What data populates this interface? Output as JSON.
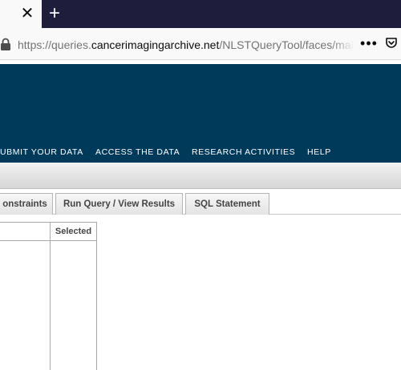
{
  "browser": {
    "tab_close_glyph": "✕",
    "new_tab_glyph": "+",
    "url_prefix": "https://queries.",
    "url_domain": "cancerimagingarchive.net",
    "url_path": "/NLSTQueryTool/faces/main.",
    "menu_glyph": "•••"
  },
  "header": {
    "nav": [
      "UBMIT YOUR DATA",
      "ACCESS THE DATA",
      "RESEARCH ACTIVITIES",
      "HELP"
    ]
  },
  "tabs": [
    {
      "label": "onstraints"
    },
    {
      "label": "Run Query / View Results"
    },
    {
      "label": "SQL Statement"
    }
  ],
  "table": {
    "selected_header": "Selected"
  },
  "colors": {
    "header_bg": "#003a5a",
    "tabstrip_bg": "#1e1e3c"
  }
}
